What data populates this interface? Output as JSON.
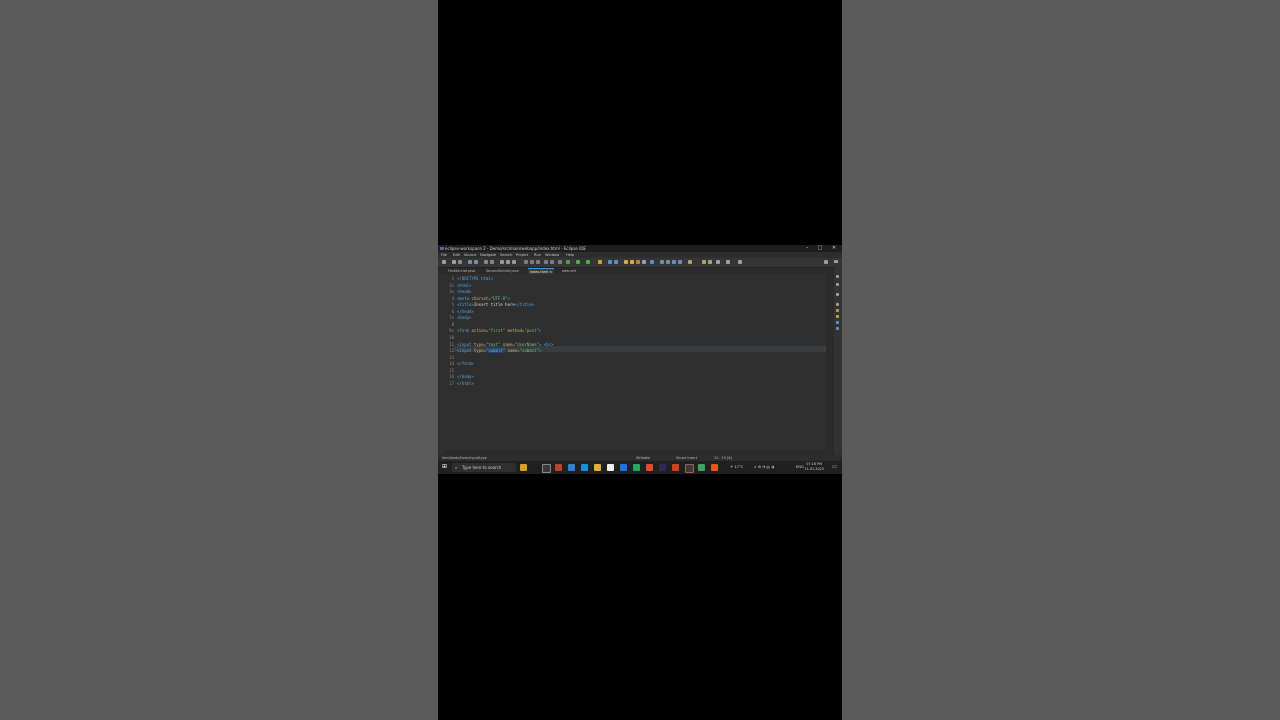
{
  "window": {
    "title": "eclipse-workspace 2 - Demo/src/main/webapp/index.html - Eclipse IDE",
    "minimize": "–",
    "maximize": "□",
    "close": "✕"
  },
  "menu": [
    "File",
    "Edit",
    "Source",
    "Navigate",
    "Search",
    "Project",
    "Run",
    "Window",
    "Help"
  ],
  "tabs": [
    {
      "label": "FirstServlet.java"
    },
    {
      "label": "SecondServlet.java"
    },
    {
      "label": "index.html ×"
    },
    {
      "label": "web.xml"
    }
  ],
  "editor": {
    "lines": [
      {
        "n": "1",
        "html": "<span class=\"tag\">&lt;!DOCTYPE html&gt;</span>"
      },
      {
        "n": "2⊖",
        "html": "<span class=\"tag\">&lt;html&gt;</span>"
      },
      {
        "n": "3⊖",
        "html": "<span class=\"tag\">&lt;head&gt;</span>"
      },
      {
        "n": "4",
        "html": "<span class=\"tag\">&lt;meta</span> <span class=\"attr\">charset=</span><span class=\"val\">\"UTF-8\"</span><span class=\"tag\">&gt;</span>"
      },
      {
        "n": "5",
        "html": "<span class=\"tag\">&lt;title&gt;</span>Insert title here<span class=\"tag\">&lt;/title&gt;</span>"
      },
      {
        "n": "6",
        "html": "<span class=\"tag\">&lt;/head&gt;</span>"
      },
      {
        "n": "7⊖",
        "html": "<span class=\"tag\">&lt;body&gt;</span>"
      },
      {
        "n": "8",
        "html": ""
      },
      {
        "n": "9⊖",
        "html": "<span class=\"tag\">&lt;form</span> <span class=\"attr\">action=</span><span class=\"val\">\"first\"</span> <span class=\"attr\">method=</span><span class=\"val\">\"post\"</span><span class=\"tag\">&gt;</span>"
      },
      {
        "n": "10",
        "html": ""
      },
      {
        "n": "11",
        "html": "<span class=\"tag\">&lt;input</span> <span class=\"attr\">type=</span><span class=\"val\">\"text\"</span> <span class=\"attr\">name=</span><span class=\"val\">\"UserName\"</span><span class=\"tag\">&gt;</span> <span class=\"tag\">&lt;br&gt;</span>"
      },
      {
        "n": "12",
        "html": "<span class=\"tag\">&lt;input</span> <span class=\"attr\">type=</span><span class=\"val\">\"<span class=\"sel\">submit</span>\"</span> <span class=\"attr\">name=</span><span class=\"val\">\"submit\"</span><span class=\"tag\">&gt;</span>"
      },
      {
        "n": "13",
        "html": ""
      },
      {
        "n": "14",
        "html": "<span class=\"tag\">&lt;/form&gt;</span>"
      },
      {
        "n": "15",
        "html": ""
      },
      {
        "n": "16",
        "html": "<span class=\"tag\">&lt;/body&gt;</span>"
      },
      {
        "n": "17",
        "html": "<span class=\"tag\">&lt;/html&gt;</span>"
      }
    ]
  },
  "status": {
    "path": "html/body/form/input/type",
    "writable": "Writable",
    "mode": "Smart Insert",
    "position": "12 : 19 [6]"
  },
  "taskbar": {
    "search_placeholder": "Type here to search",
    "weather": "17°C",
    "lang": "ENG",
    "time": "07:18 PM",
    "date": "11-01-2025"
  },
  "colors": {
    "tag": "#4fa6e6",
    "attr": "#c9b36a",
    "value": "#6ec08a",
    "selection": "#214283",
    "editor_bg": "#2f2f2f"
  }
}
